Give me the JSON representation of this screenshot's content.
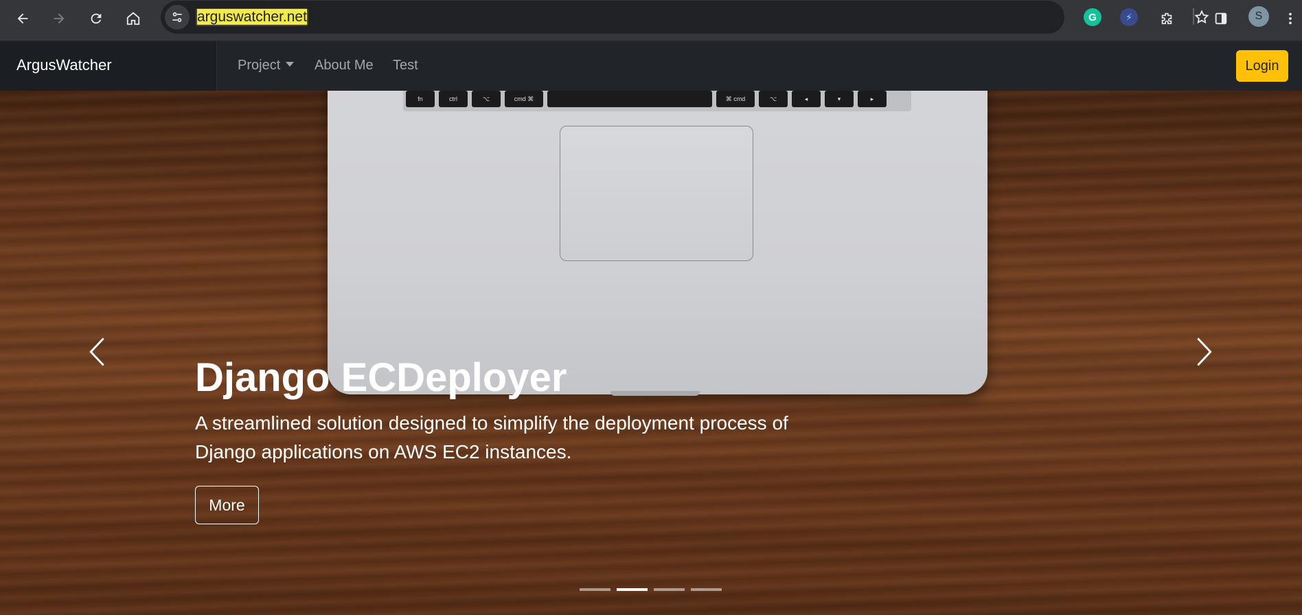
{
  "browser": {
    "url": "arguswatcher.net",
    "profile_initial": "S",
    "extensions": [
      {
        "name": "grammarly-extension",
        "letter": "G",
        "color": "#15c39a"
      },
      {
        "name": "bolt-extension",
        "letter": "⚡",
        "color": "#4a5fa8"
      }
    ]
  },
  "navbar": {
    "brand": "ArgusWatcher",
    "links": [
      {
        "label": "Project",
        "dropdown": true
      },
      {
        "label": "About Me"
      },
      {
        "label": "Test"
      }
    ],
    "login_label": "Login"
  },
  "hero": {
    "title": "Django ECDeployer",
    "description": "A streamlined solution designed to simplify the deployment process of Django applications on AWS EC2 instances.",
    "button_label": "More",
    "slide_count": 4,
    "active_slide": 2
  },
  "laptop_keys": [
    "fn",
    "ctrl",
    "⌥",
    "cmd ⌘",
    "",
    "⌘ cmd",
    "⌥",
    "◂",
    "▾",
    "▸"
  ],
  "colors": {
    "navbar_bg": "#212529",
    "login_bg": "#ffc107",
    "chrome_bg": "#35363a"
  }
}
